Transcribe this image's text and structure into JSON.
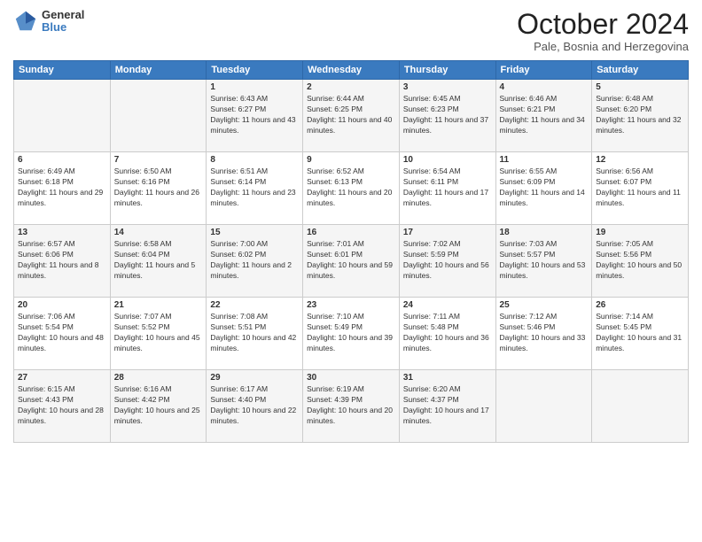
{
  "logo": {
    "general": "General",
    "blue": "Blue"
  },
  "title": "October 2024",
  "location": "Pale, Bosnia and Herzegovina",
  "days_header": [
    "Sunday",
    "Monday",
    "Tuesday",
    "Wednesday",
    "Thursday",
    "Friday",
    "Saturday"
  ],
  "weeks": [
    [
      {
        "day": "",
        "sunrise": "",
        "sunset": "",
        "daylight": ""
      },
      {
        "day": "",
        "sunrise": "",
        "sunset": "",
        "daylight": ""
      },
      {
        "day": "1",
        "sunrise": "Sunrise: 6:43 AM",
        "sunset": "Sunset: 6:27 PM",
        "daylight": "Daylight: 11 hours and 43 minutes."
      },
      {
        "day": "2",
        "sunrise": "Sunrise: 6:44 AM",
        "sunset": "Sunset: 6:25 PM",
        "daylight": "Daylight: 11 hours and 40 minutes."
      },
      {
        "day": "3",
        "sunrise": "Sunrise: 6:45 AM",
        "sunset": "Sunset: 6:23 PM",
        "daylight": "Daylight: 11 hours and 37 minutes."
      },
      {
        "day": "4",
        "sunrise": "Sunrise: 6:46 AM",
        "sunset": "Sunset: 6:21 PM",
        "daylight": "Daylight: 11 hours and 34 minutes."
      },
      {
        "day": "5",
        "sunrise": "Sunrise: 6:48 AM",
        "sunset": "Sunset: 6:20 PM",
        "daylight": "Daylight: 11 hours and 32 minutes."
      }
    ],
    [
      {
        "day": "6",
        "sunrise": "Sunrise: 6:49 AM",
        "sunset": "Sunset: 6:18 PM",
        "daylight": "Daylight: 11 hours and 29 minutes."
      },
      {
        "day": "7",
        "sunrise": "Sunrise: 6:50 AM",
        "sunset": "Sunset: 6:16 PM",
        "daylight": "Daylight: 11 hours and 26 minutes."
      },
      {
        "day": "8",
        "sunrise": "Sunrise: 6:51 AM",
        "sunset": "Sunset: 6:14 PM",
        "daylight": "Daylight: 11 hours and 23 minutes."
      },
      {
        "day": "9",
        "sunrise": "Sunrise: 6:52 AM",
        "sunset": "Sunset: 6:13 PM",
        "daylight": "Daylight: 11 hours and 20 minutes."
      },
      {
        "day": "10",
        "sunrise": "Sunrise: 6:54 AM",
        "sunset": "Sunset: 6:11 PM",
        "daylight": "Daylight: 11 hours and 17 minutes."
      },
      {
        "day": "11",
        "sunrise": "Sunrise: 6:55 AM",
        "sunset": "Sunset: 6:09 PM",
        "daylight": "Daylight: 11 hours and 14 minutes."
      },
      {
        "day": "12",
        "sunrise": "Sunrise: 6:56 AM",
        "sunset": "Sunset: 6:07 PM",
        "daylight": "Daylight: 11 hours and 11 minutes."
      }
    ],
    [
      {
        "day": "13",
        "sunrise": "Sunrise: 6:57 AM",
        "sunset": "Sunset: 6:06 PM",
        "daylight": "Daylight: 11 hours and 8 minutes."
      },
      {
        "day": "14",
        "sunrise": "Sunrise: 6:58 AM",
        "sunset": "Sunset: 6:04 PM",
        "daylight": "Daylight: 11 hours and 5 minutes."
      },
      {
        "day": "15",
        "sunrise": "Sunrise: 7:00 AM",
        "sunset": "Sunset: 6:02 PM",
        "daylight": "Daylight: 11 hours and 2 minutes."
      },
      {
        "day": "16",
        "sunrise": "Sunrise: 7:01 AM",
        "sunset": "Sunset: 6:01 PM",
        "daylight": "Daylight: 10 hours and 59 minutes."
      },
      {
        "day": "17",
        "sunrise": "Sunrise: 7:02 AM",
        "sunset": "Sunset: 5:59 PM",
        "daylight": "Daylight: 10 hours and 56 minutes."
      },
      {
        "day": "18",
        "sunrise": "Sunrise: 7:03 AM",
        "sunset": "Sunset: 5:57 PM",
        "daylight": "Daylight: 10 hours and 53 minutes."
      },
      {
        "day": "19",
        "sunrise": "Sunrise: 7:05 AM",
        "sunset": "Sunset: 5:56 PM",
        "daylight": "Daylight: 10 hours and 50 minutes."
      }
    ],
    [
      {
        "day": "20",
        "sunrise": "Sunrise: 7:06 AM",
        "sunset": "Sunset: 5:54 PM",
        "daylight": "Daylight: 10 hours and 48 minutes."
      },
      {
        "day": "21",
        "sunrise": "Sunrise: 7:07 AM",
        "sunset": "Sunset: 5:52 PM",
        "daylight": "Daylight: 10 hours and 45 minutes."
      },
      {
        "day": "22",
        "sunrise": "Sunrise: 7:08 AM",
        "sunset": "Sunset: 5:51 PM",
        "daylight": "Daylight: 10 hours and 42 minutes."
      },
      {
        "day": "23",
        "sunrise": "Sunrise: 7:10 AM",
        "sunset": "Sunset: 5:49 PM",
        "daylight": "Daylight: 10 hours and 39 minutes."
      },
      {
        "day": "24",
        "sunrise": "Sunrise: 7:11 AM",
        "sunset": "Sunset: 5:48 PM",
        "daylight": "Daylight: 10 hours and 36 minutes."
      },
      {
        "day": "25",
        "sunrise": "Sunrise: 7:12 AM",
        "sunset": "Sunset: 5:46 PM",
        "daylight": "Daylight: 10 hours and 33 minutes."
      },
      {
        "day": "26",
        "sunrise": "Sunrise: 7:14 AM",
        "sunset": "Sunset: 5:45 PM",
        "daylight": "Daylight: 10 hours and 31 minutes."
      }
    ],
    [
      {
        "day": "27",
        "sunrise": "Sunrise: 6:15 AM",
        "sunset": "Sunset: 4:43 PM",
        "daylight": "Daylight: 10 hours and 28 minutes."
      },
      {
        "day": "28",
        "sunrise": "Sunrise: 6:16 AM",
        "sunset": "Sunset: 4:42 PM",
        "daylight": "Daylight: 10 hours and 25 minutes."
      },
      {
        "day": "29",
        "sunrise": "Sunrise: 6:17 AM",
        "sunset": "Sunset: 4:40 PM",
        "daylight": "Daylight: 10 hours and 22 minutes."
      },
      {
        "day": "30",
        "sunrise": "Sunrise: 6:19 AM",
        "sunset": "Sunset: 4:39 PM",
        "daylight": "Daylight: 10 hours and 20 minutes."
      },
      {
        "day": "31",
        "sunrise": "Sunrise: 6:20 AM",
        "sunset": "Sunset: 4:37 PM",
        "daylight": "Daylight: 10 hours and 17 minutes."
      },
      {
        "day": "",
        "sunrise": "",
        "sunset": "",
        "daylight": ""
      },
      {
        "day": "",
        "sunrise": "",
        "sunset": "",
        "daylight": ""
      }
    ]
  ]
}
